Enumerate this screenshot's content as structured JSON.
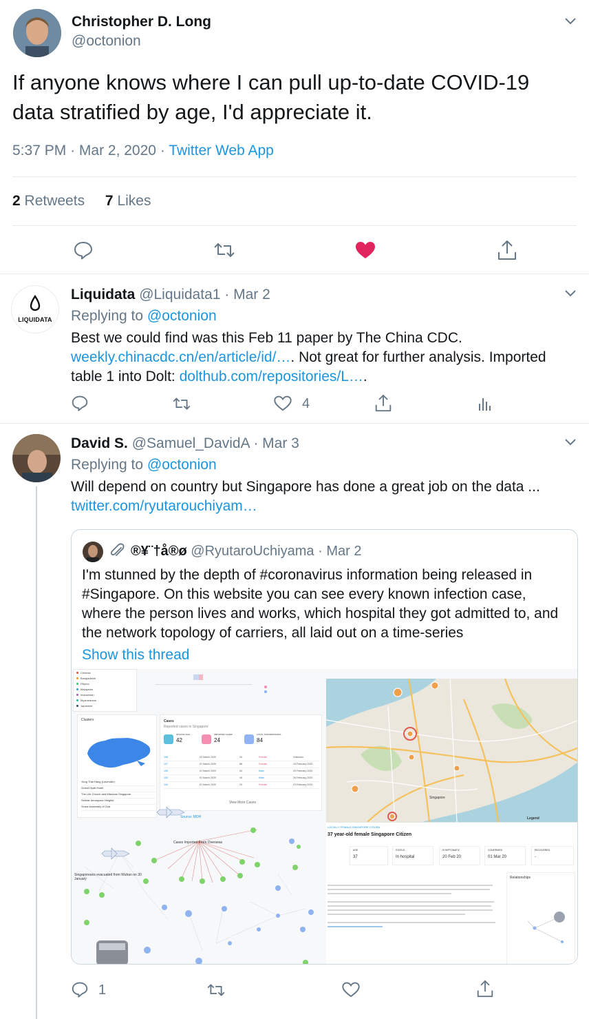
{
  "main_tweet": {
    "author_name": "Christopher D. Long",
    "author_handle": "@octonion",
    "text_line1": "If anyone knows where I can pull up-to-date COVID-19",
    "text_line2": "data stratified by age, I'd appreciate it.",
    "time": "5:37 PM",
    "sep1": "·",
    "date": "Mar 2, 2020",
    "sep2": "·",
    "source": "Twitter Web App",
    "retweets_count": "2",
    "retweets_label": "Retweets",
    "likes_count": "7",
    "likes_label": "Likes"
  },
  "reply1": {
    "author_name": "Liquidata",
    "author_handle": "@Liquidata1",
    "sep": "·",
    "date": "Mar 2",
    "avatar_text": "LIQUIDATA",
    "replying_prefix": "Replying to",
    "replying_to": "@octonion",
    "line1": "Best we could find was this Feb 11 paper by The China CDC.",
    "link1": "weekly.chinacdc.cn/en/article/id/…",
    "line2_rest": ". Not great for further analysis. Imported",
    "line3_prefix": "table 1 into Dolt:",
    "link2": "dolthub.com/repositories/L…",
    "line3_end": ".",
    "like_count": "4"
  },
  "reply2": {
    "author_name": "David S.",
    "author_handle": "@Samuel_DavidA",
    "sep": "·",
    "date": "Mar 3",
    "replying_prefix": "Replying to",
    "replying_to": "@octonion",
    "line1": "Will depend on country but Singapore has done a great job on the data ...",
    "link": "twitter.com/ryutarouchiyam…",
    "reply_count": "1"
  },
  "quoted": {
    "author_name": "®¥¨†å®ø",
    "author_handle": "@RyutaroUchiyama",
    "sep": "·",
    "date": "Mar 2",
    "line1": "I'm stunned by the depth of #coronavirus information being released in",
    "line2": "#Singapore. On this website you can see every known infection case,",
    "line3": "where the person lives and works, which hospital they got admitted to, and",
    "line4": "the network topology of carriers, all laid out on a time-series",
    "show_thread": "Show this thread"
  },
  "dashboard": {
    "clusters_title": "Clusters",
    "cases_title": "Cases",
    "cases_sub": "Reported cases in Singapore",
    "stat1_label": "STAYING SGH",
    "stat1_value": "42",
    "stat2_label": "IMPORTED CASES",
    "stat2_value": "24",
    "stat3_label": "LOCAL TRANSMISSIONS",
    "stat3_value": "84",
    "view_more": "View More Cases",
    "source_label": "Source: MOH",
    "imported_label": "Cases Imported From Overseas",
    "evac_label": "Singaporeans evacuated from Wuhan on 30 January",
    "legend_label": "Legend",
    "patient_header": "LOCALLY FEMALE SINGAPORE CITIZEN",
    "patient_title": "37 year-old female Singapore Citizen",
    "age_label": "AGE",
    "age_value": "37",
    "status_label": "STATUS",
    "status_value": "In hospital",
    "symptomatic_label": "SYMPTOMATIC",
    "symptomatic_value": "20 Feb 20",
    "confirmed_label": "CONFIRMED",
    "confirmed_value": "01 Mar 20",
    "recovered_label": "RECOVERED",
    "recovered_value": "-",
    "relationships_label": "Relationships",
    "map_label": "Singapore",
    "cluster_rows": [
      "Yong Thai Hang (Lavender)",
      "Grand Hyatt Hotel",
      "The Life Church and Missions Singapore",
      "Seletar Aerospace Heights",
      "Grace Assembly of God"
    ],
    "nationality_rows": [
      "Chinese",
      "Bangladeshi",
      "Filipino",
      "Malaysian",
      "Indonesian",
      "Myanmarese",
      "Japanese"
    ],
    "case_rows": [
      {
        "id": "108",
        "date": "02 March 2020",
        "age": "34",
        "gender": "Female",
        "sym": "Unknown"
      },
      {
        "id": "107",
        "date": "01 March 2020",
        "age": "88",
        "gender": "Female",
        "sym": "15 February 2020"
      },
      {
        "id": "106",
        "date": "01 March 2020",
        "age": "54",
        "gender": "Male",
        "sym": "25 February 2020"
      },
      {
        "id": "105",
        "date": "01 March 2020",
        "age": "49",
        "gender": "Male",
        "sym": "26 February 2020"
      },
      {
        "id": "104",
        "date": "01 March 2020",
        "age": "23",
        "gender": "Female",
        "sym": "23 February 2020"
      }
    ]
  },
  "colors": {
    "link": "#1b95e0",
    "muted": "#657786",
    "like_active": "#e0245e",
    "divider": "#e6ecf0"
  }
}
